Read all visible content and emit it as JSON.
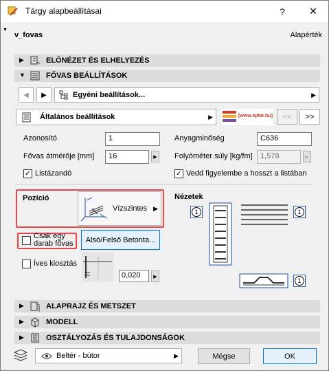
{
  "window": {
    "title": "Tárgy alapbeállításai",
    "help": "?",
    "close": "✕"
  },
  "header": {
    "name": "v_fovas",
    "default_label": "Alapérték"
  },
  "sections": {
    "preview": "ELŐNÉZET ÉS ELHELYEZÉS",
    "rebar": "FŐVAS BEÁLLÍTÁSOK",
    "floorplan": "ALAPRAJZ ÉS METSZET",
    "model": "MODELL",
    "classification": "OSZTÁLYOZÁS ÉS TULAJDONSÁGOK"
  },
  "nav": {
    "custom_settings": "Egyéni beállítások...",
    "general_settings": "Általános beállítások",
    "brand": "[www.eptar.hu]",
    "prev": "<<",
    "next": ">>"
  },
  "fields": {
    "id_label": "Azonosító",
    "id_value": "1",
    "diameter_label": "Fővas átmérője [mm]",
    "diameter_value": "16",
    "listable_label": "Listázandó",
    "material_label": "Anyagminőség",
    "material_value": "C636",
    "weight_label": "Folyóméter súly [kg/fm]",
    "weight_value": "1,578",
    "length_label": "Vedd figyelembe a hosszt a listában"
  },
  "position": {
    "label": "Pozíció",
    "value": "Vízszintes"
  },
  "options": {
    "single_rebar": "Csak egy darab fővas",
    "curved_spacing": "Íves kiosztás",
    "curved_value": "0,020",
    "layer_button": "Alsó/Felső Betonta..."
  },
  "views": {
    "label": "Nézetek",
    "badge": "1"
  },
  "footer": {
    "layer": "Beltér - bútor",
    "cancel": "Mégse",
    "ok": "OK"
  },
  "colors": {
    "accent": "#0078d7",
    "highlight": "#e8474a",
    "logo_red": "#d63a2f",
    "logo_yellow": "#f5a623",
    "logo_purple": "#7a4fa0"
  }
}
